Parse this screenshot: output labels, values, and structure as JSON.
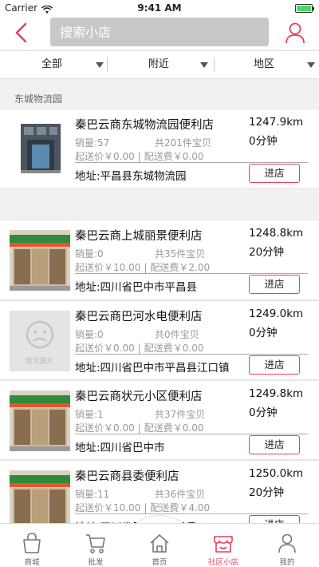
{
  "status_bar": {
    "carrier": "Carrier",
    "time": "9:41 AM"
  },
  "search": {
    "placeholder": "搜索小店"
  },
  "filters": [
    {
      "label": "全部"
    },
    {
      "label": "附近"
    },
    {
      "label": "地区"
    }
  ],
  "section_title": "东城物流园",
  "stores": [
    {
      "name": "秦巴云商东城物流园便利店",
      "distance": "1247.9km",
      "duration": "0分钟",
      "sales": "销量:57",
      "items": "共201件宝贝",
      "min_order": "起送价￥0.00",
      "delivery_fee": "配送费￥0.00",
      "address": "地址:平昌县东城物流园",
      "action": "进店",
      "image": "store-photo-building"
    },
    {
      "name": "秦巴云商上城丽景便利店",
      "distance": "1248.8km",
      "duration": "20分钟",
      "sales": "销量:0",
      "items": "共35件宝贝",
      "min_order": "起送价￥10.00",
      "delivery_fee": "配送费￥2.00",
      "address": "地址:四川省巴中市平昌县",
      "action": "进店",
      "image": "store-photo-shopfront"
    },
    {
      "name": "秦巴云商巴河水电便利店",
      "distance": "1249.0km",
      "duration": "0分钟",
      "sales": "销量:0",
      "items": "共0件宝贝",
      "min_order": "起送价￥0.00",
      "delivery_fee": "配送费￥0.00",
      "address": "地址:四川省巴中市平昌县江口镇",
      "action": "进店",
      "image": "no-image-placeholder",
      "placeholder_text": "暂无图片"
    },
    {
      "name": "秦巴云商状元小区便利店",
      "distance": "1249.8km",
      "duration": "0分钟",
      "sales": "销量:1",
      "items": "共37件宝贝",
      "min_order": "起送价￥0.00",
      "delivery_fee": "配送费￥0.00",
      "address": "地址:四川省巴中市",
      "action": "进店",
      "image": "store-photo-shopfront"
    },
    {
      "name": "秦巴云商县委便利店",
      "distance": "1250.0km",
      "duration": "20分钟",
      "sales": "销量:11",
      "items": "共36件宝贝",
      "min_order": "起送价￥10.00",
      "delivery_fee": "配送费￥4.00",
      "address": "地址:四川省巴中市平昌县",
      "action": "进店",
      "image": "store-photo-shopfront"
    }
  ],
  "tabs": [
    {
      "label": "商城",
      "icon": "shopping-bag-icon"
    },
    {
      "label": "批发",
      "icon": "cart-icon"
    },
    {
      "label": "首页",
      "icon": "home-icon"
    },
    {
      "label": "社区小店",
      "icon": "shop-icon",
      "active": true
    },
    {
      "label": "我的",
      "icon": "person-icon"
    }
  ],
  "colors": {
    "accent": "#e5415b",
    "search_bg": "#c8c8c8",
    "page_bg": "#f1f1f1"
  }
}
